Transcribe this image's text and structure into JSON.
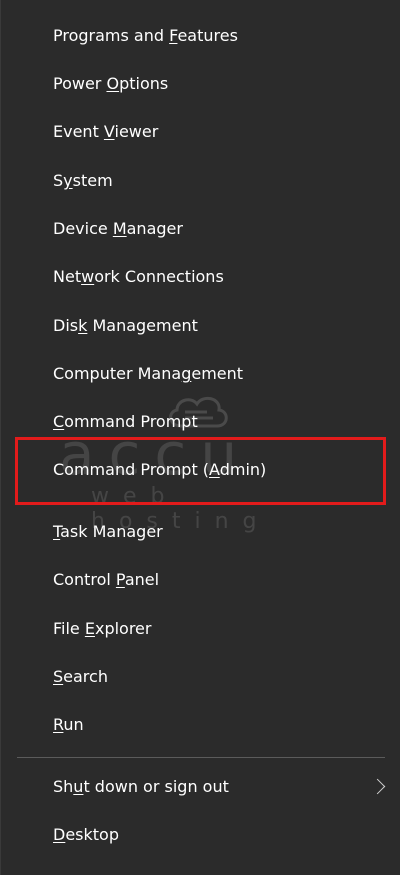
{
  "menu": {
    "items": [
      {
        "before": "Programs and ",
        "key": "F",
        "after": "eatures"
      },
      {
        "before": "Power ",
        "key": "O",
        "after": "ptions"
      },
      {
        "before": "Event ",
        "key": "V",
        "after": "iewer"
      },
      {
        "before": "S",
        "key": "y",
        "after": "stem"
      },
      {
        "before": "Device ",
        "key": "M",
        "after": "anager"
      },
      {
        "before": "Net",
        "key": "w",
        "after": "ork Connections"
      },
      {
        "before": "Dis",
        "key": "k",
        "after": " Management"
      },
      {
        "before": "Computer Mana",
        "key": "g",
        "after": "ement"
      },
      {
        "before": "",
        "key": "C",
        "after": "ommand Prompt"
      },
      {
        "before": "Command Prompt (",
        "key": "A",
        "after": "dmin)"
      },
      {
        "before": "",
        "key": "T",
        "after": "ask Manager"
      },
      {
        "before": "Control ",
        "key": "P",
        "after": "anel"
      },
      {
        "before": "File ",
        "key": "E",
        "after": "xplorer"
      },
      {
        "before": "",
        "key": "S",
        "after": "earch"
      },
      {
        "before": "",
        "key": "R",
        "after": "un"
      }
    ],
    "footer_items": [
      {
        "before": "Sh",
        "key": "u",
        "after": "t down or sign out"
      },
      {
        "before": "",
        "key": "D",
        "after": "esktop"
      }
    ]
  },
  "watermark": {
    "main": "accu",
    "sub": "web hosting"
  },
  "colors": {
    "background": "#2b2b2b",
    "text": "#ffffff",
    "highlight_border": "#e21b1b",
    "separator": "#5b5b5b"
  },
  "icons": {
    "submenu": "chevron-right-icon",
    "watermark_logo": "cloud-icon"
  }
}
